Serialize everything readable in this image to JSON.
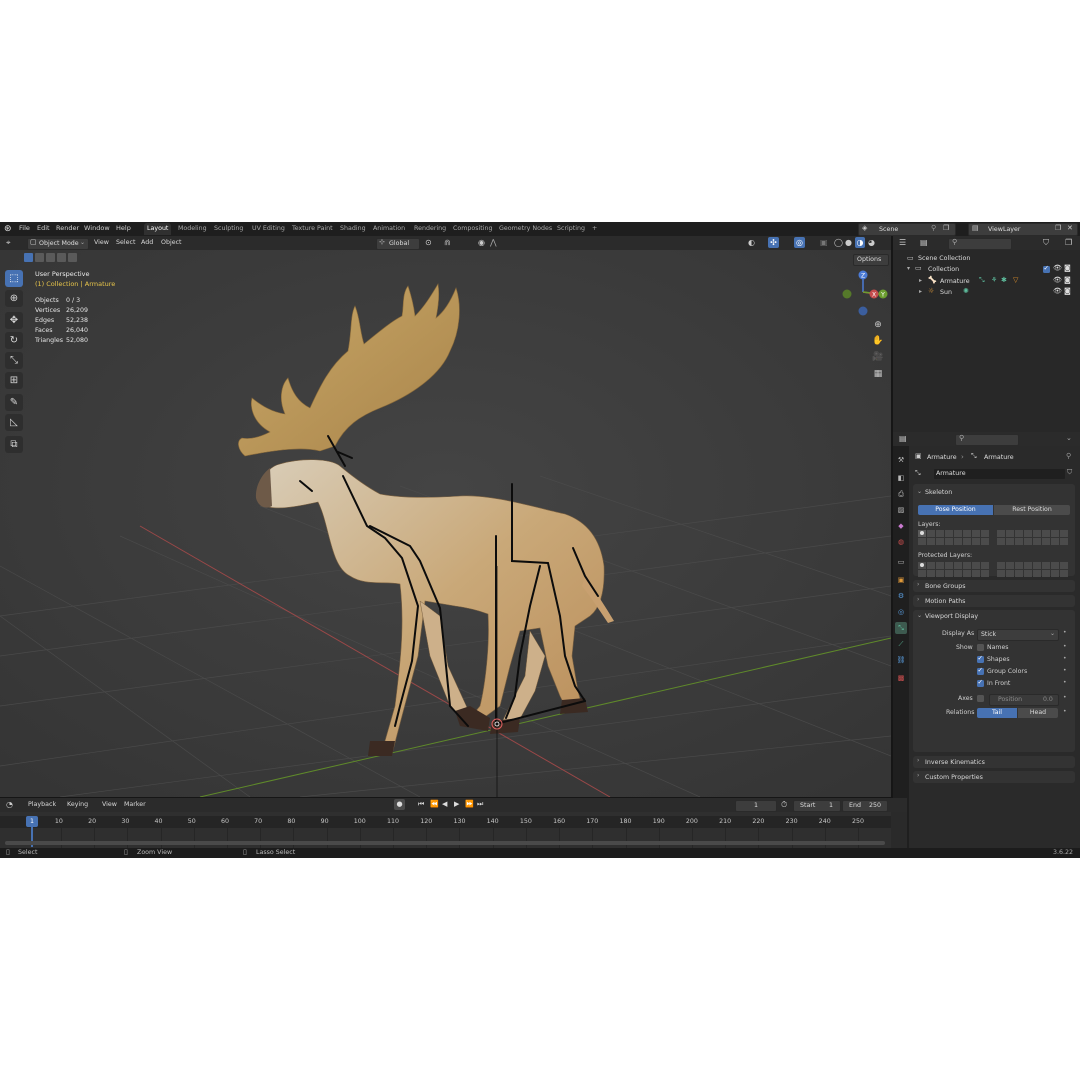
{
  "topbar": {
    "menus": [
      "File",
      "Edit",
      "Render",
      "Window",
      "Help"
    ],
    "workspaces": [
      "Layout",
      "Modeling",
      "Sculpting",
      "UV Editing",
      "Texture Paint",
      "Shading",
      "Animation",
      "Rendering",
      "Compositing",
      "Geometry Nodes",
      "Scripting"
    ],
    "add_tab": "+",
    "scene": "Scene",
    "view_layer": "ViewLayer"
  },
  "viewport_header": {
    "mode": "Object Mode",
    "menus": [
      "View",
      "Select",
      "Add",
      "Object"
    ],
    "transform": "Global",
    "options": "Options"
  },
  "overlay": {
    "perspective": "User Perspective",
    "collection": "(1) Collection | Armature",
    "stats": [
      {
        "label": "Objects",
        "value": "0 / 3"
      },
      {
        "label": "Vertices",
        "value": "26,209"
      },
      {
        "label": "Edges",
        "value": "52,238"
      },
      {
        "label": "Faces",
        "value": "26,040"
      },
      {
        "label": "Triangles",
        "value": "52,080"
      }
    ]
  },
  "gizmo": {
    "x": "X",
    "y": "Y",
    "z": "Z"
  },
  "outliner": {
    "root": "Scene Collection",
    "collection": "Collection",
    "items": [
      "Armature",
      "Sun"
    ]
  },
  "properties": {
    "breadcrumb_1": "Armature",
    "breadcrumb_2": "Armature",
    "data_name": "Armature",
    "skeleton": {
      "title": "Skeleton",
      "pose_position": "Pose Position",
      "rest_position": "Rest Position",
      "layers": "Layers:",
      "protected_layers": "Protected Layers:"
    },
    "bone_groups": "Bone Groups",
    "motion_paths": "Motion Paths",
    "viewport_display": {
      "title": "Viewport Display",
      "display_as_label": "Display As",
      "display_as_value": "Stick",
      "show_label": "Show",
      "names": "Names",
      "shapes": "Shapes",
      "group_colors": "Group Colors",
      "in_front": "In Front",
      "axes_label": "Axes",
      "position_label": "Position",
      "position_value": "0.0",
      "relations_label": "Relations",
      "tail": "Tail",
      "head": "Head"
    },
    "inverse_kinematics": "Inverse Kinematics",
    "custom_properties": "Custom Properties"
  },
  "timeline": {
    "menus": [
      "Playback",
      "Keying",
      "View",
      "Marker"
    ],
    "current_frame": "1",
    "start_label": "Start",
    "start_value": "1",
    "end_label": "End",
    "end_value": "250",
    "ticks": [
      "10",
      "20",
      "30",
      "40",
      "50",
      "60",
      "70",
      "80",
      "90",
      "100",
      "110",
      "120",
      "130",
      "140",
      "150",
      "160",
      "170",
      "180",
      "190",
      "200",
      "210",
      "220",
      "230",
      "240",
      "250"
    ]
  },
  "statusbar": {
    "select": "Select",
    "zoom": "Zoom View",
    "lasso": "Lasso Select",
    "version": "3.6.22"
  },
  "colors": {
    "accent": "#4772b3",
    "viewport_bg": "#3a3a3a",
    "overlay_yellow": "#e8c54a",
    "axis_red": "#c44c4c",
    "axis_green": "#6b9e2f",
    "axis_blue": "#4b7bd6"
  }
}
